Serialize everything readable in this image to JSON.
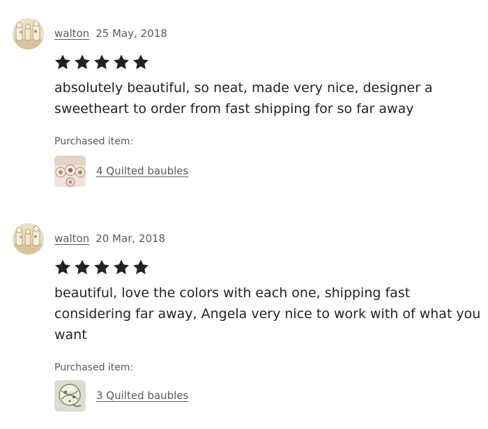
{
  "reviews": [
    {
      "reviewer": "walton",
      "date": "25 May, 2018",
      "rating": 5,
      "text": "absolutely beautiful, so neat, made very nice, designer a sweetheart to order from fast shipping for so far away",
      "purchased_label": "Purchased item:",
      "item": "4 Quilted baubles"
    },
    {
      "reviewer": "walton",
      "date": "20 Mar, 2018",
      "rating": 5,
      "text": "beautiful, love the colors with each one, shipping fast considering far away, Angela very nice to work with of what you want",
      "purchased_label": "Purchased item:",
      "item": "3 Quilted baubles"
    }
  ],
  "colors": {
    "text": "#222222",
    "muted": "#595959",
    "star": "#222222"
  }
}
